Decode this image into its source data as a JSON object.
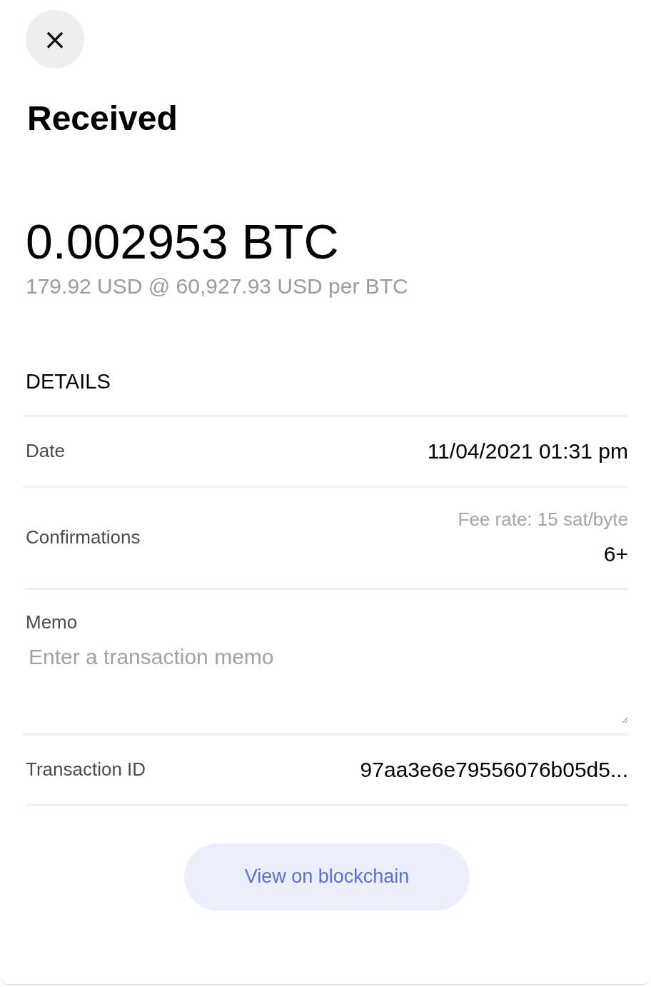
{
  "close_button": {
    "label": "×"
  },
  "title": "Received",
  "amount": "0.002953 BTC",
  "fiat_line": "179.92 USD @ 60,927.93 USD per BTC",
  "details_heading": "DETAILS",
  "rows": [
    {
      "kind": "value",
      "label": "Date",
      "value": "11/04/2021 01:31 pm"
    },
    {
      "kind": "confirmations",
      "label": "Confirmations",
      "note": "Fee rate: 15 sat/byte",
      "value": "6+"
    },
    {
      "kind": "memo",
      "label": "Memo",
      "placeholder": "Enter a transaction memo"
    },
    {
      "kind": "value",
      "label": "Transaction ID",
      "value": "97aa3e6e79556076b05d5..."
    }
  ],
  "action_button": {
    "label": "View on blockchain"
  }
}
